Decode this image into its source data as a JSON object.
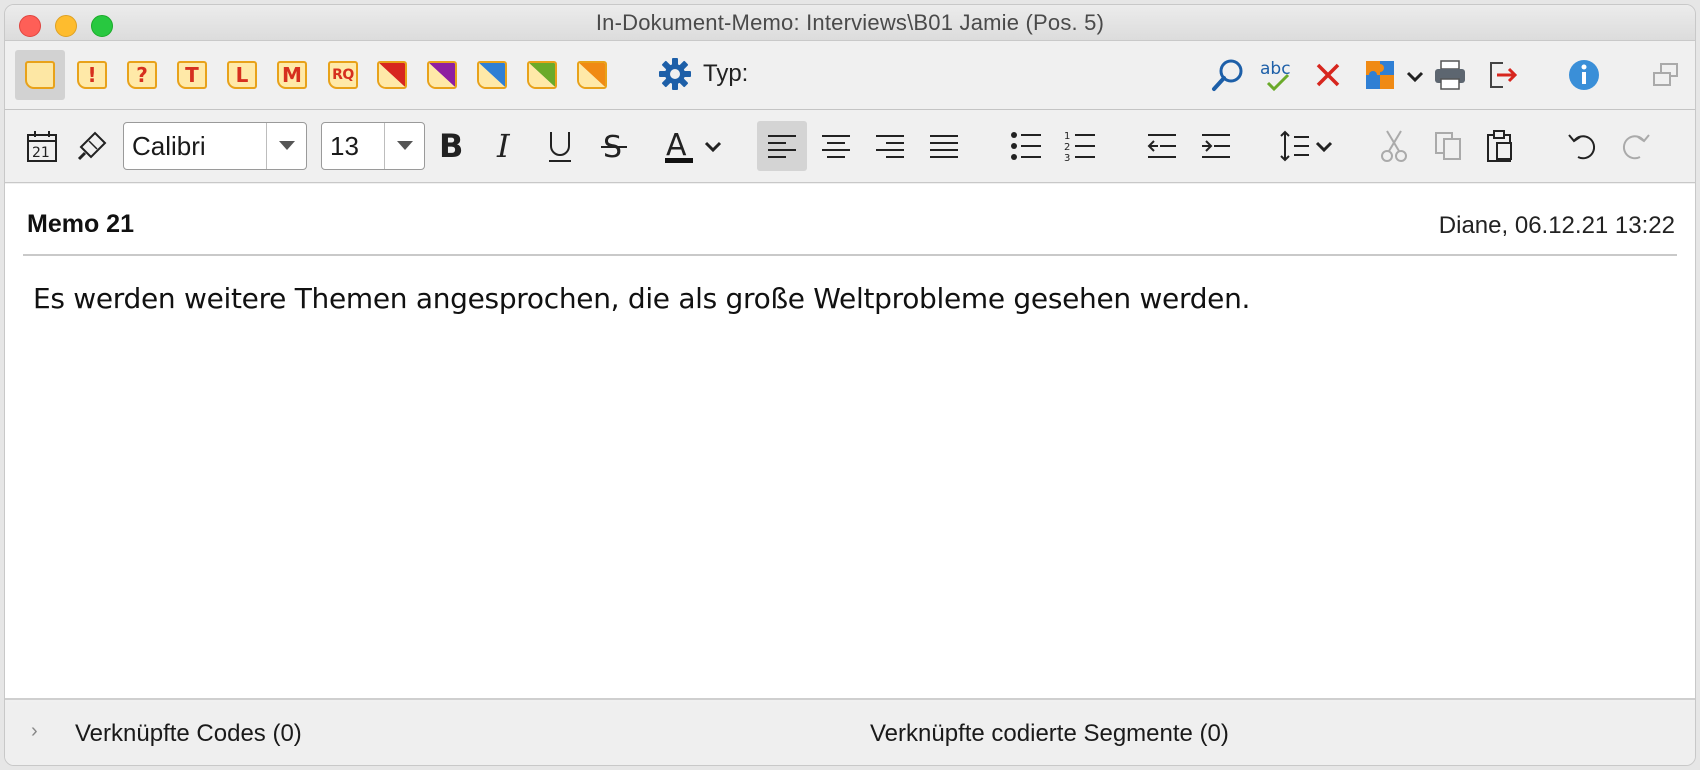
{
  "window": {
    "title": "In-Dokument-Memo: Interviews\\B01 Jamie (Pos. 5)"
  },
  "memo_types": [
    {
      "icon": "memo-plain-icon",
      "glyph": ""
    },
    {
      "icon": "memo-exclamation-icon",
      "glyph": "!"
    },
    {
      "icon": "memo-question-icon",
      "glyph": "?"
    },
    {
      "icon": "memo-t-icon",
      "glyph": "T"
    },
    {
      "icon": "memo-l-icon",
      "glyph": "L"
    },
    {
      "icon": "memo-m-icon",
      "glyph": "M"
    },
    {
      "icon": "memo-rq-icon",
      "glyph": "RQ"
    }
  ],
  "memo_color_types": [
    {
      "icon": "memo-red-icon",
      "color": "#d7261e"
    },
    {
      "icon": "memo-purple-icon",
      "color": "#8e1fa0"
    },
    {
      "icon": "memo-blue-icon",
      "color": "#2f7fd4"
    },
    {
      "icon": "memo-green-icon",
      "color": "#6aaa2a"
    },
    {
      "icon": "memo-orange-icon",
      "color": "#f08a14"
    }
  ],
  "toolbar": {
    "type_label": "Typ:"
  },
  "format": {
    "font_family": "Calibri",
    "font_size": "13",
    "date_icon_text": "21"
  },
  "memo": {
    "name": "Memo 21",
    "author_date": "Diane, 06.12.21 13:22",
    "body": "Es werden weitere Themen angesprochen, die als große Weltprobleme gesehen werden."
  },
  "footer": {
    "linked_codes": "Verknüpfte Codes (0)",
    "linked_segments": "Verknüpfte codierte Segmente (0)"
  },
  "colors": {
    "memo_border": "#e8a21a",
    "memo_fill": "#ffe9a8",
    "memo_glyph": "#d62f1e",
    "accent_blue": "#1d5fa8"
  }
}
